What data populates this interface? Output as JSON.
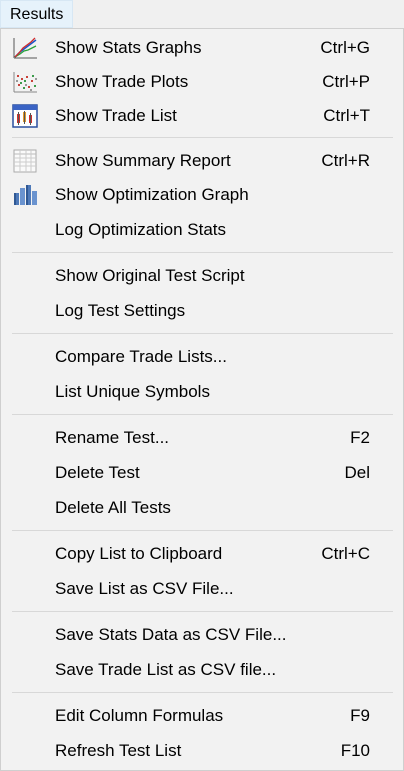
{
  "menubar": {
    "results": "Results"
  },
  "groups": [
    {
      "items": [
        {
          "name": "show-stats-graphs",
          "icon": "stats-graph-icon",
          "label": "Show Stats Graphs",
          "shortcut": "Ctrl+G"
        },
        {
          "name": "show-trade-plots",
          "icon": "trade-plots-icon",
          "label": "Show Trade Plots",
          "shortcut": "Ctrl+P"
        },
        {
          "name": "show-trade-list",
          "icon": "trade-list-icon",
          "label": "Show Trade List",
          "shortcut": "Ctrl+T"
        }
      ]
    },
    {
      "items": [
        {
          "name": "show-summary-report",
          "icon": "summary-report-icon",
          "label": "Show Summary Report",
          "shortcut": "Ctrl+R"
        },
        {
          "name": "show-optimization-graph",
          "icon": "optimization-graph-icon",
          "label": "Show Optimization Graph",
          "shortcut": ""
        },
        {
          "name": "log-optimization-stats",
          "icon": "",
          "label": "Log Optimization Stats",
          "shortcut": ""
        }
      ]
    },
    {
      "items": [
        {
          "name": "show-original-test-script",
          "icon": "",
          "label": "Show Original Test Script",
          "shortcut": ""
        },
        {
          "name": "log-test-settings",
          "icon": "",
          "label": "Log Test Settings",
          "shortcut": ""
        }
      ]
    },
    {
      "items": [
        {
          "name": "compare-trade-lists",
          "icon": "",
          "label": "Compare Trade Lists...",
          "shortcut": ""
        },
        {
          "name": "list-unique-symbols",
          "icon": "",
          "label": "List Unique Symbols",
          "shortcut": ""
        }
      ]
    },
    {
      "items": [
        {
          "name": "rename-test",
          "icon": "",
          "label": "Rename Test...",
          "shortcut": "F2"
        },
        {
          "name": "delete-test",
          "icon": "",
          "label": "Delete Test",
          "shortcut": "Del"
        },
        {
          "name": "delete-all-tests",
          "icon": "",
          "label": "Delete All Tests",
          "shortcut": ""
        }
      ]
    },
    {
      "items": [
        {
          "name": "copy-list-to-clipboard",
          "icon": "",
          "label": "Copy List to Clipboard",
          "shortcut": "Ctrl+C"
        },
        {
          "name": "save-list-as-csv",
          "icon": "",
          "label": "Save List as CSV File...",
          "shortcut": ""
        }
      ]
    },
    {
      "items": [
        {
          "name": "save-stats-data-as-csv",
          "icon": "",
          "label": "Save Stats Data as CSV File...",
          "shortcut": ""
        },
        {
          "name": "save-trade-list-as-csv",
          "icon": "",
          "label": "Save Trade List as CSV file...",
          "shortcut": ""
        }
      ]
    },
    {
      "items": [
        {
          "name": "edit-column-formulas",
          "icon": "",
          "label": "Edit Column Formulas",
          "shortcut": "F9"
        },
        {
          "name": "refresh-test-list",
          "icon": "",
          "label": "Refresh Test List",
          "shortcut": "F10"
        }
      ]
    }
  ]
}
